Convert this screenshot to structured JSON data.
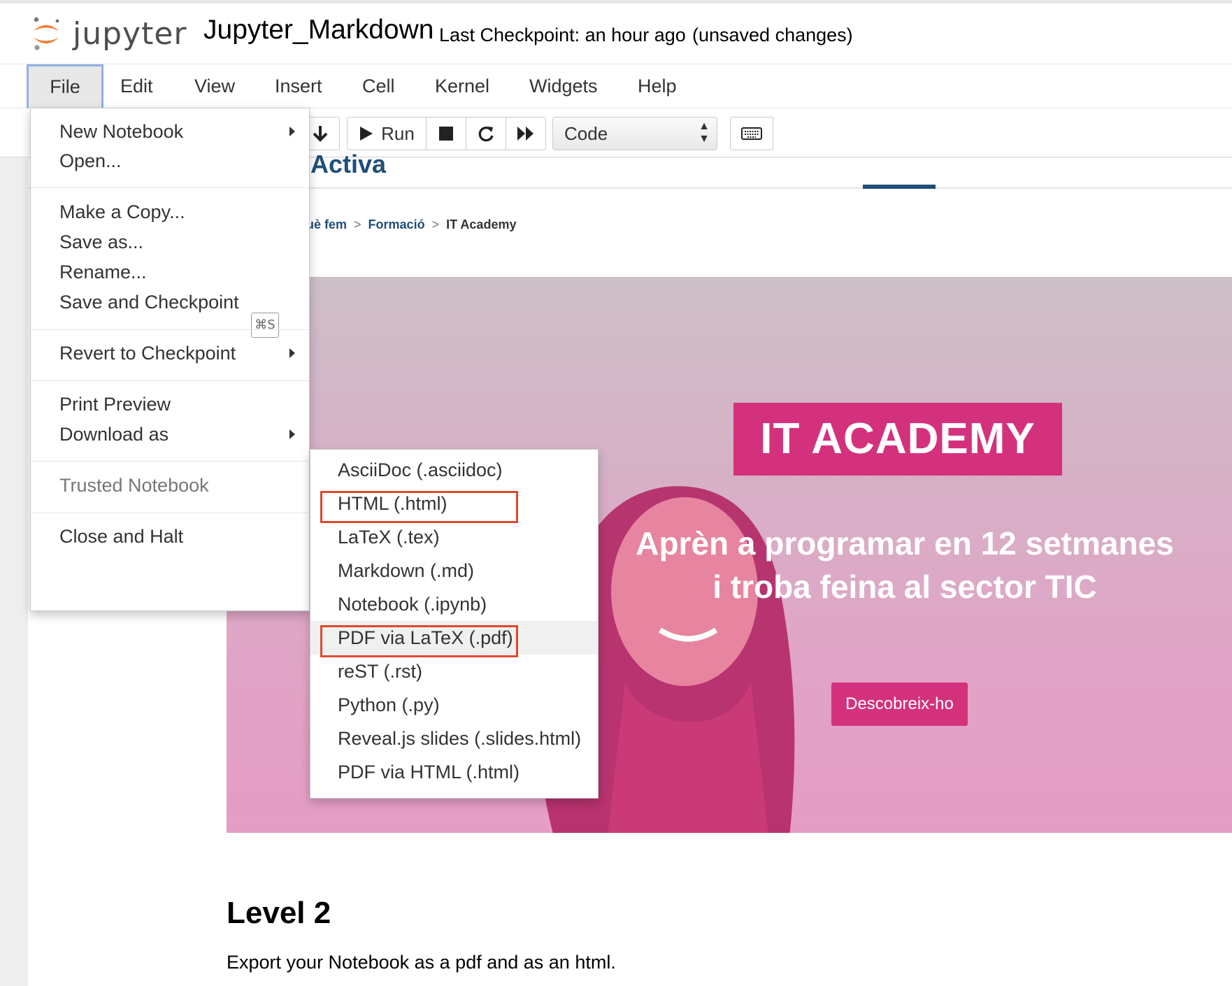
{
  "header": {
    "logo_text": "jupyter",
    "notebook_name": "Jupyter_Markdown",
    "checkpoint": "Last Checkpoint: an hour ago",
    "status": "(unsaved changes)"
  },
  "menubar": {
    "items": [
      "File",
      "Edit",
      "View",
      "Insert",
      "Cell",
      "Kernel",
      "Widgets",
      "Help"
    ]
  },
  "toolbar": {
    "run_label": "Run",
    "cell_type": "Code"
  },
  "file_menu": {
    "items": [
      {
        "label": "New Notebook",
        "submenu": true
      },
      {
        "label": "Open..."
      },
      {
        "label": "Make a Copy..."
      },
      {
        "label": "Save as..."
      },
      {
        "label": "Rename..."
      },
      {
        "label": "Save and Checkpoint",
        "shortcut": "⌘S"
      },
      {
        "label": "Revert to Checkpoint",
        "submenu": true
      },
      {
        "label": "Print Preview"
      },
      {
        "label": "Download as",
        "submenu": true
      },
      {
        "label": "Trusted Notebook",
        "disabled": true
      },
      {
        "label": "Close and Halt"
      }
    ]
  },
  "download_menu": {
    "items": [
      "AsciiDoc (.asciidoc)",
      "HTML (.html)",
      "LaTeX (.tex)",
      "Markdown (.md)",
      "Notebook (.ipynb)",
      "PDF via LaTeX (.pdf)",
      "reST (.rst)",
      "Python (.py)",
      "Reveal.js slides (.slides.html)",
      "PDF via HTML (.html)"
    ],
    "highlighted": [
      "HTML (.html)",
      "PDF via LaTeX (.pdf)"
    ]
  },
  "notebook": {
    "site_brand_partial": "Activa",
    "breadcrumb": [
      "uè fem",
      "Formació",
      "IT Academy"
    ],
    "hero_badge": "IT ACADEMY",
    "hero_text": "Aprèn a programar en 12 setmanes i troba feina al sector TIC",
    "hero_button": "Descobreix-ho",
    "heading": "Level 2",
    "paragraph": "Export your Notebook as a pdf and as an html."
  },
  "colors": {
    "accent_pink": "#d4317c",
    "brand_blue": "#1f4e79",
    "highlight_red": "#e0482e",
    "jupyter_orange": "#f37726"
  }
}
